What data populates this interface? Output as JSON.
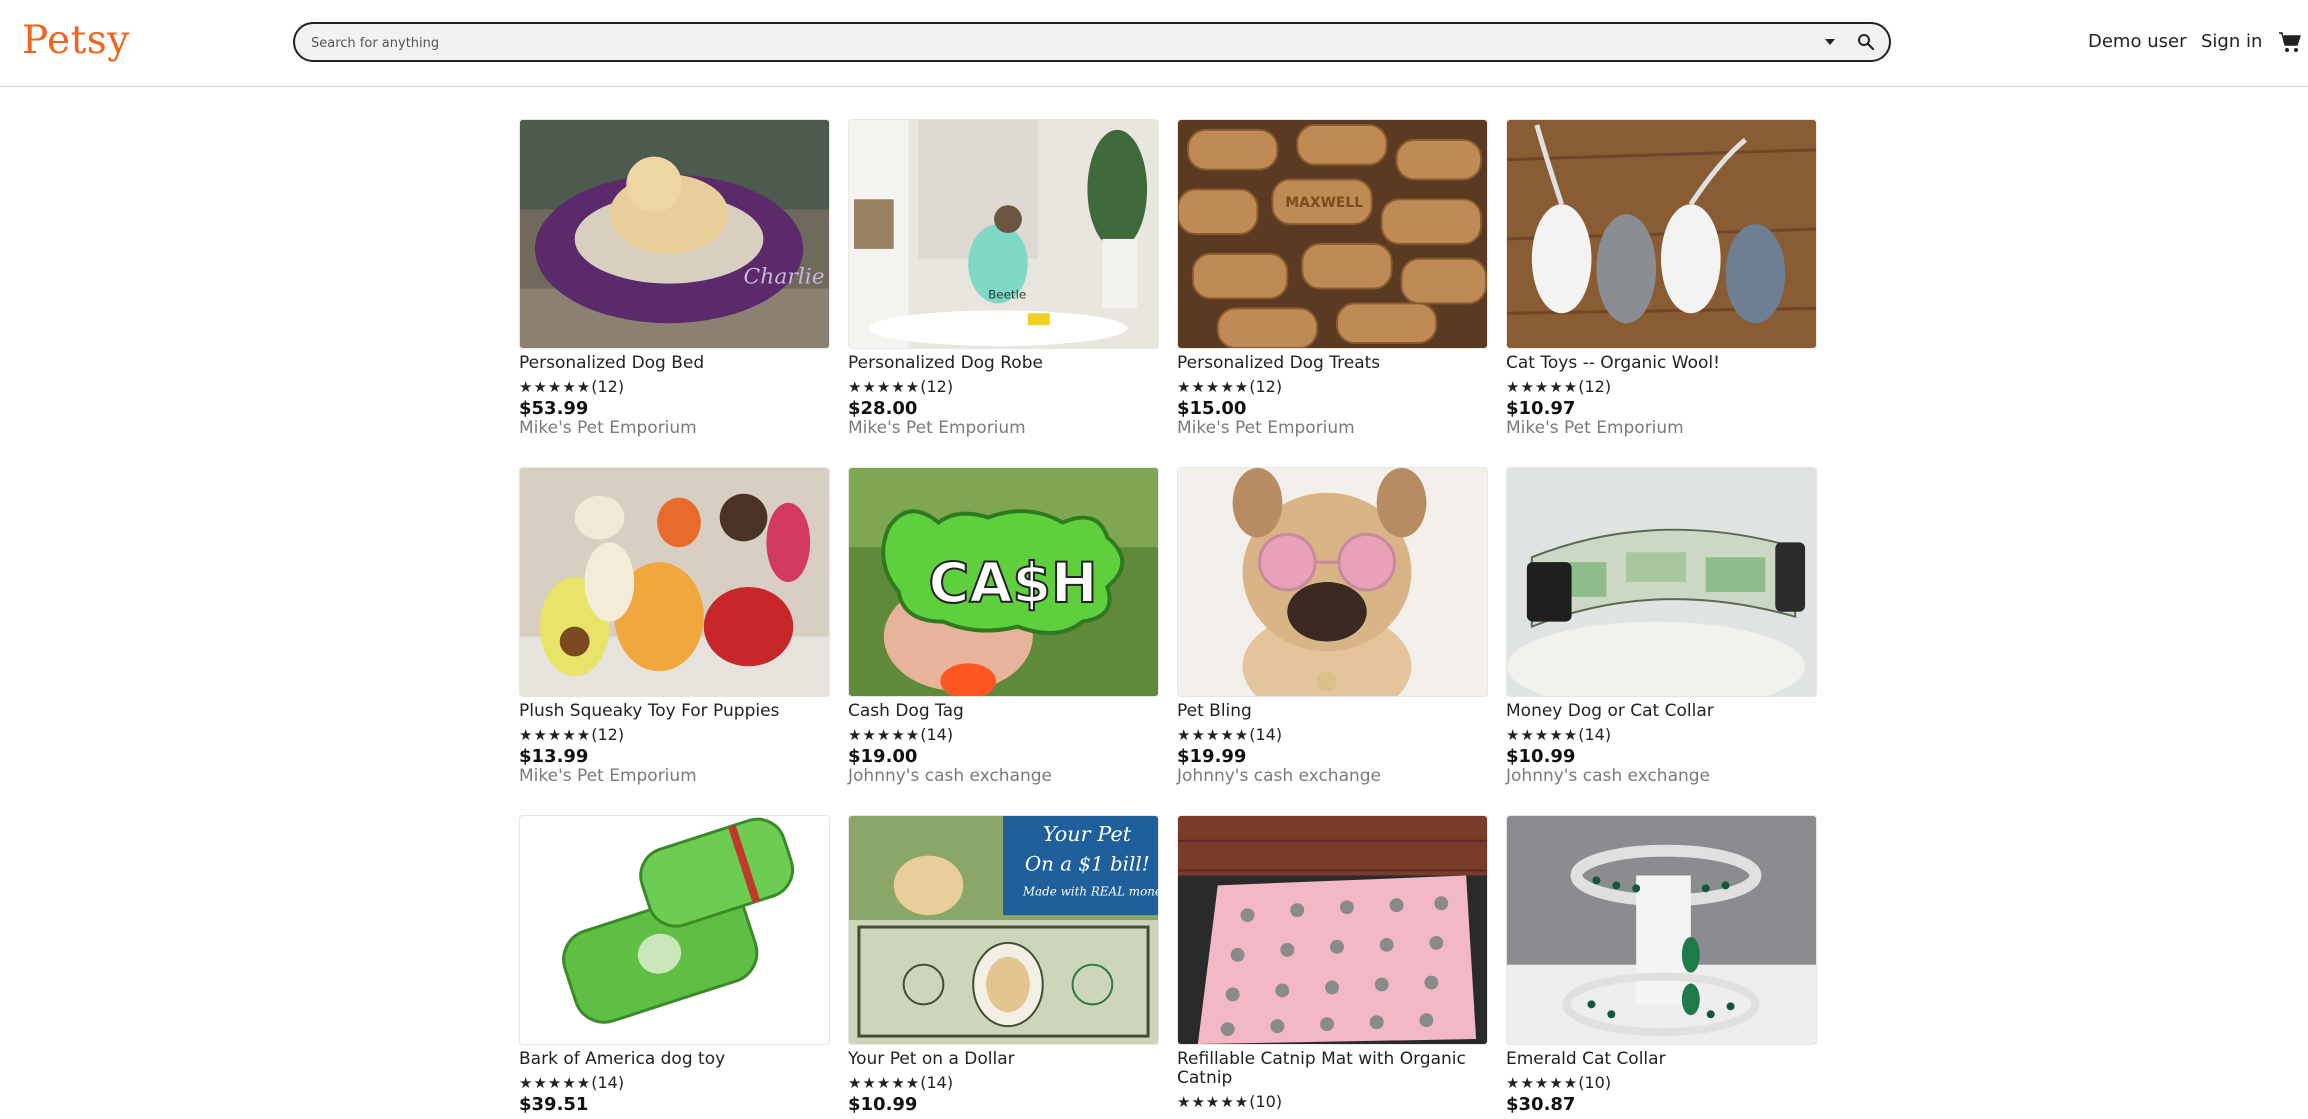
{
  "header": {
    "logo": "Petsy",
    "search_placeholder": "Search for anything",
    "demo_user": "Demo user",
    "sign_in": "Sign in"
  },
  "products": [
    {
      "title": "Personalized Dog Bed",
      "stars": "★★★★★",
      "reviews": "(12)",
      "price": "$53.99",
      "shop": "Mike's Pet Emporium"
    },
    {
      "title": "Personalized Dog Robe",
      "stars": "★★★★★",
      "reviews": "(12)",
      "price": "$28.00",
      "shop": "Mike's Pet Emporium"
    },
    {
      "title": "Personalized Dog Treats",
      "stars": "★★★★★",
      "reviews": "(12)",
      "price": "$15.00",
      "shop": "Mike's Pet Emporium"
    },
    {
      "title": "Cat Toys -- Organic Wool!",
      "stars": "★★★★★",
      "reviews": "(12)",
      "price": "$10.97",
      "shop": "Mike's Pet Emporium"
    },
    {
      "title": "Plush Squeaky Toy For Puppies",
      "stars": "★★★★★",
      "reviews": "(12)",
      "price": "$13.99",
      "shop": "Mike's Pet Emporium"
    },
    {
      "title": "Cash Dog Tag",
      "stars": "★★★★★",
      "reviews": "(14)",
      "price": "$19.00",
      "shop": "Johnny's cash exchange"
    },
    {
      "title": "Pet Bling",
      "stars": "★★★★★",
      "reviews": "(14)",
      "price": "$19.99",
      "shop": "Johnny's cash exchange"
    },
    {
      "title": "Money Dog or Cat Collar",
      "stars": "★★★★★",
      "reviews": "(14)",
      "price": "$10.99",
      "shop": "Johnny's cash exchange"
    },
    {
      "title": "Bark of America dog toy",
      "stars": "★★★★★",
      "reviews": "(14)",
      "price": "$39.51",
      "shop": ""
    },
    {
      "title": "Your Pet on a Dollar",
      "stars": "★★★★★",
      "reviews": "(14)",
      "price": "$10.99",
      "shop": ""
    },
    {
      "title": "Refillable Catnip Mat with Organic Catnip",
      "stars": "★★★★★",
      "reviews": "(10)",
      "price": "",
      "shop": ""
    },
    {
      "title": "Emerald Cat Collar",
      "stars": "★★★★★",
      "reviews": "(10)",
      "price": "$30.87",
      "shop": ""
    }
  ],
  "image_text": {
    "dollar_banner_1": "Your Pet",
    "dollar_banner_2": "On a $1 bill!",
    "dollar_banner_3": "Made with REAL money!",
    "dog_tag_word": "CA$H",
    "dog_bed_name": "Charlie",
    "dog_robe_name": "Beetle",
    "treat_word": "MAXWELL"
  },
  "colors": {
    "brand": "#f1641e",
    "shop_text": "#7a7a7a"
  }
}
